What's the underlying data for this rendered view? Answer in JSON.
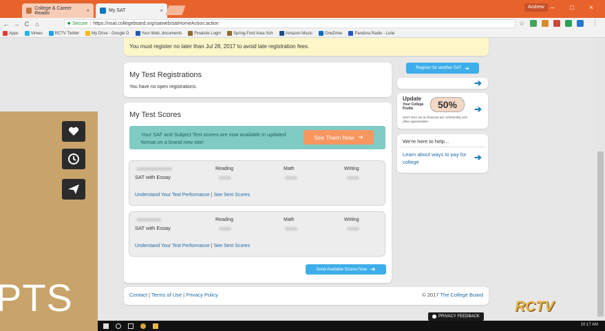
{
  "tabs": [
    {
      "title": "College & Career Readin",
      "close": "×",
      "active": false
    },
    {
      "title": "My SAT",
      "close": "×",
      "active": true
    }
  ],
  "window": {
    "user": "Andrew",
    "minimize": "–",
    "maximize": "□",
    "close": "×"
  },
  "address": {
    "back": "←",
    "forward": "→",
    "reload": "C",
    "home": "⌂",
    "secure_label": "Secure",
    "url": "https://nsat.collegeboard.org/satweb/satHomeAction.action",
    "star": "☆"
  },
  "bookmarks": [
    "Apps",
    "Vimeo",
    "RCTV Twitter",
    "My Drive - Google D",
    "Your Web, documents",
    "Finalsite Login",
    "Spring-Ford Area Sch",
    "Amazon Music",
    "OneDrive",
    "Pandora Radio - Liste"
  ],
  "notice": {
    "text": "You must register no later than Jul 28, 2017 to avoid late registration fees."
  },
  "registrations": {
    "title": "My Test Registrations",
    "empty": "You have no open registrations."
  },
  "scores": {
    "title": "My Test Scores",
    "banner_text": "Your SAT and Subject Test scores are now available in updated format on a brand new site!",
    "see_button": "See Them Now",
    "columns": [
      "Reading",
      "Math",
      "Writing"
    ],
    "entries": [
      {
        "test": "SAT with Essay",
        "link1": "Understand Your Test Performance",
        "sep": "|",
        "link2": "See Sent Scores"
      },
      {
        "test": "SAT with Essay",
        "link1": "Understand Your Test Performance",
        "sep": "|",
        "link2": "See Sent Scores"
      }
    ],
    "send_button": "Send Available Scores Now"
  },
  "sidebar": {
    "register_button": "Register for another SAT",
    "update_title": "Update",
    "update_sub": "Your College Profile",
    "update_percent": "50%",
    "update_note": "Don't miss out on financial aid, scholarship and other opportunities",
    "help_title": "We're here to help...",
    "help_link": "Learn about ways to pay for college"
  },
  "footer": {
    "contact": "Contact",
    "terms": "Terms of Use",
    "privacy": "Privacy Policy",
    "sep": "|",
    "copyright": "© 2017",
    "copyright_link": "The College Board"
  },
  "overlay": {
    "pts_text": "PTS"
  },
  "privacy_feedback": "PRIVACY FEEDBACK",
  "logo": "RCTV",
  "clock": "10:17 AM",
  "colors": {
    "accent_orange": "#e8632b",
    "button_blue": "#3daee9",
    "banner_teal": "#80cbc4",
    "cta_orange": "#f7965e",
    "share_gold": "#c8a36a"
  }
}
